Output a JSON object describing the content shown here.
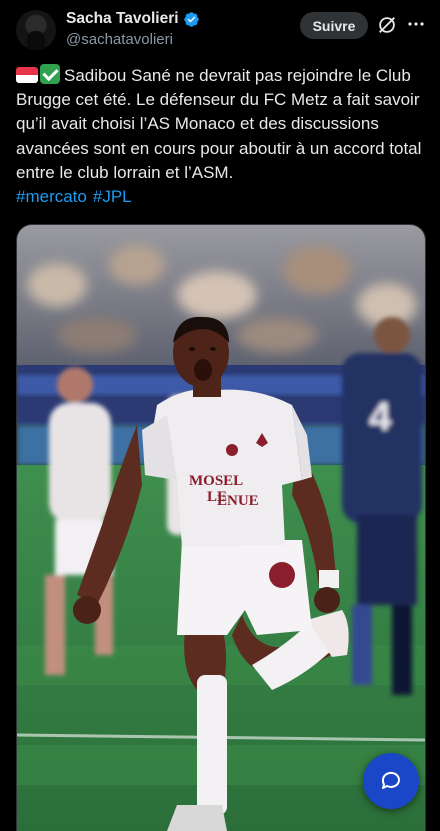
{
  "author": {
    "display_name": "Sacha Tavolieri",
    "handle": "@sachatavolieri",
    "verified": true
  },
  "actions": {
    "follow_label": "Suivre",
    "grok_icon": "grok-slash-circle-icon",
    "more_icon": "more-dots-icon"
  },
  "post": {
    "emoji_prefix": [
      "monaco-flag-emoji",
      "check-mark-emoji"
    ],
    "text": "Sadibou Sané ne devrait pas rejoindre le Club Brugge cet été. Le défenseur du FC Metz a fait savoir qu’il avait choisi l’AS Monaco et des discussions avancées sont en cours pour aboutir à un accord total entre le club lorrain et l’ASM.",
    "hashtags": [
      "#mercato",
      "#JPL"
    ]
  },
  "media": {
    "description_icon": "photo",
    "shirt_number": "4",
    "shirt_sponsor_line1": "MOSEL",
    "shirt_sponsor_line2": "LE",
    "shirt_sponsor_line3": "ENUE"
  },
  "fab": {
    "icon": "compose-message-icon"
  },
  "colors": {
    "background": "#000000",
    "text": "#e7e9ea",
    "secondary": "#8b98a5",
    "link": "#1d9bf0",
    "verified": "#1d9bf0",
    "fab": "#1a47c7",
    "follow_bg": "#2f3336"
  }
}
